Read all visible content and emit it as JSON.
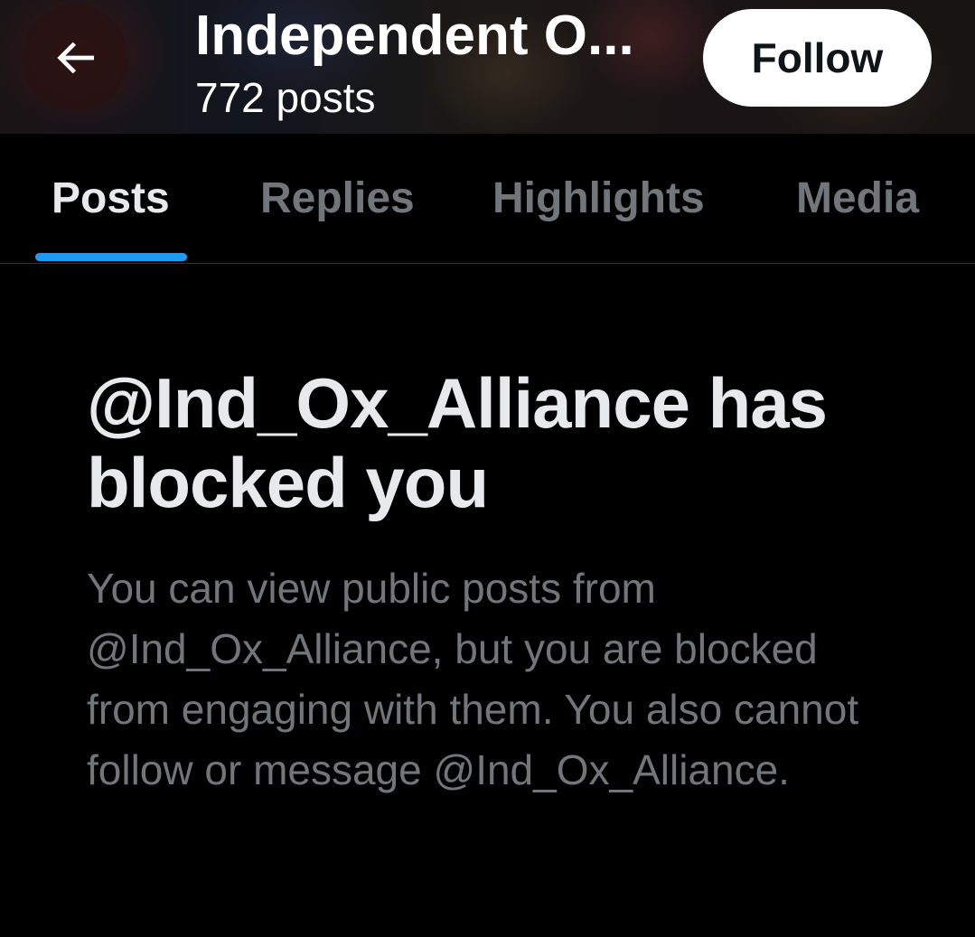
{
  "header": {
    "title": "Independent O...",
    "post_count": "772 posts",
    "follow_label": "Follow",
    "back_icon": "arrow-left-icon"
  },
  "tabs": [
    {
      "label": "Posts",
      "active": true
    },
    {
      "label": "Replies",
      "active": false
    },
    {
      "label": "Highlights",
      "active": false
    },
    {
      "label": "Media",
      "active": false
    }
  ],
  "blocked": {
    "title": "@Ind_Ox_Alliance has blocked you",
    "body": "You can view public posts from @Ind_Ox_Alliance, but you are blocked from engaging with them. You also cannot follow or message @Ind_Ox_Alliance."
  },
  "colors": {
    "background": "#000000",
    "accent": "#1d9bf0",
    "primary_text": "#e7e9ea",
    "secondary_text": "#71767b",
    "divider": "#2f3336"
  }
}
